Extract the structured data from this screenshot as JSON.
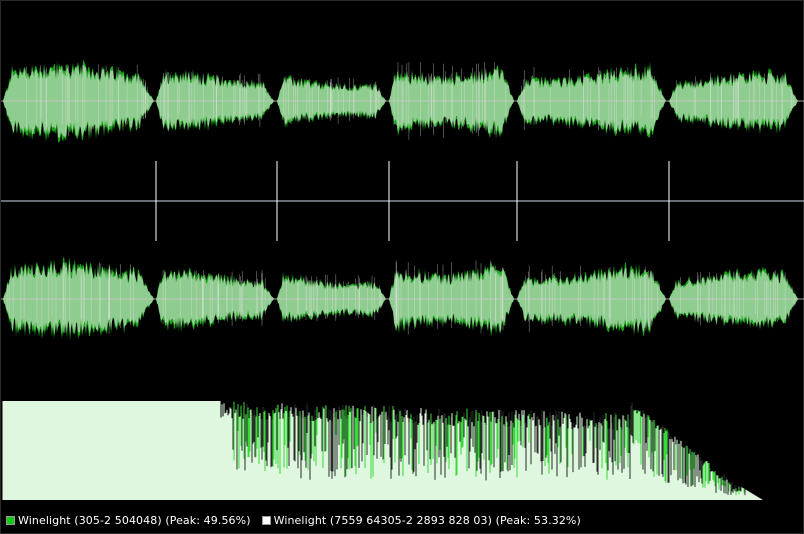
{
  "colors": {
    "background": "#000000",
    "wave_fill": "#8fcc8f",
    "wave_peak": "#1fbf1f",
    "wave_white": "#e6e6e6",
    "center_line": "#c8c8c8",
    "divider_line": "#8a8f99",
    "spectrum_fill": "#dff7df",
    "spectrum_peak": "#1bd31b",
    "legend_green": "#18c818",
    "legend_white": "#ffffff"
  },
  "segments": [
    {
      "amplitude": 0.78
    },
    {
      "amplitude": 0.62
    },
    {
      "amplitude": 0.52
    },
    {
      "amplitude": 0.82
    },
    {
      "amplitude": 0.72
    },
    {
      "amplitude": 0.6
    }
  ],
  "legend": [
    {
      "label": "Winelight (305-2 504048) (Peak: 49.56%)",
      "color_key": "legend_green"
    },
    {
      "label": "Winelight (7559 64305-2 2893 828 03) (Peak: 53.32%)",
      "color_key": "legend_white"
    }
  ]
}
